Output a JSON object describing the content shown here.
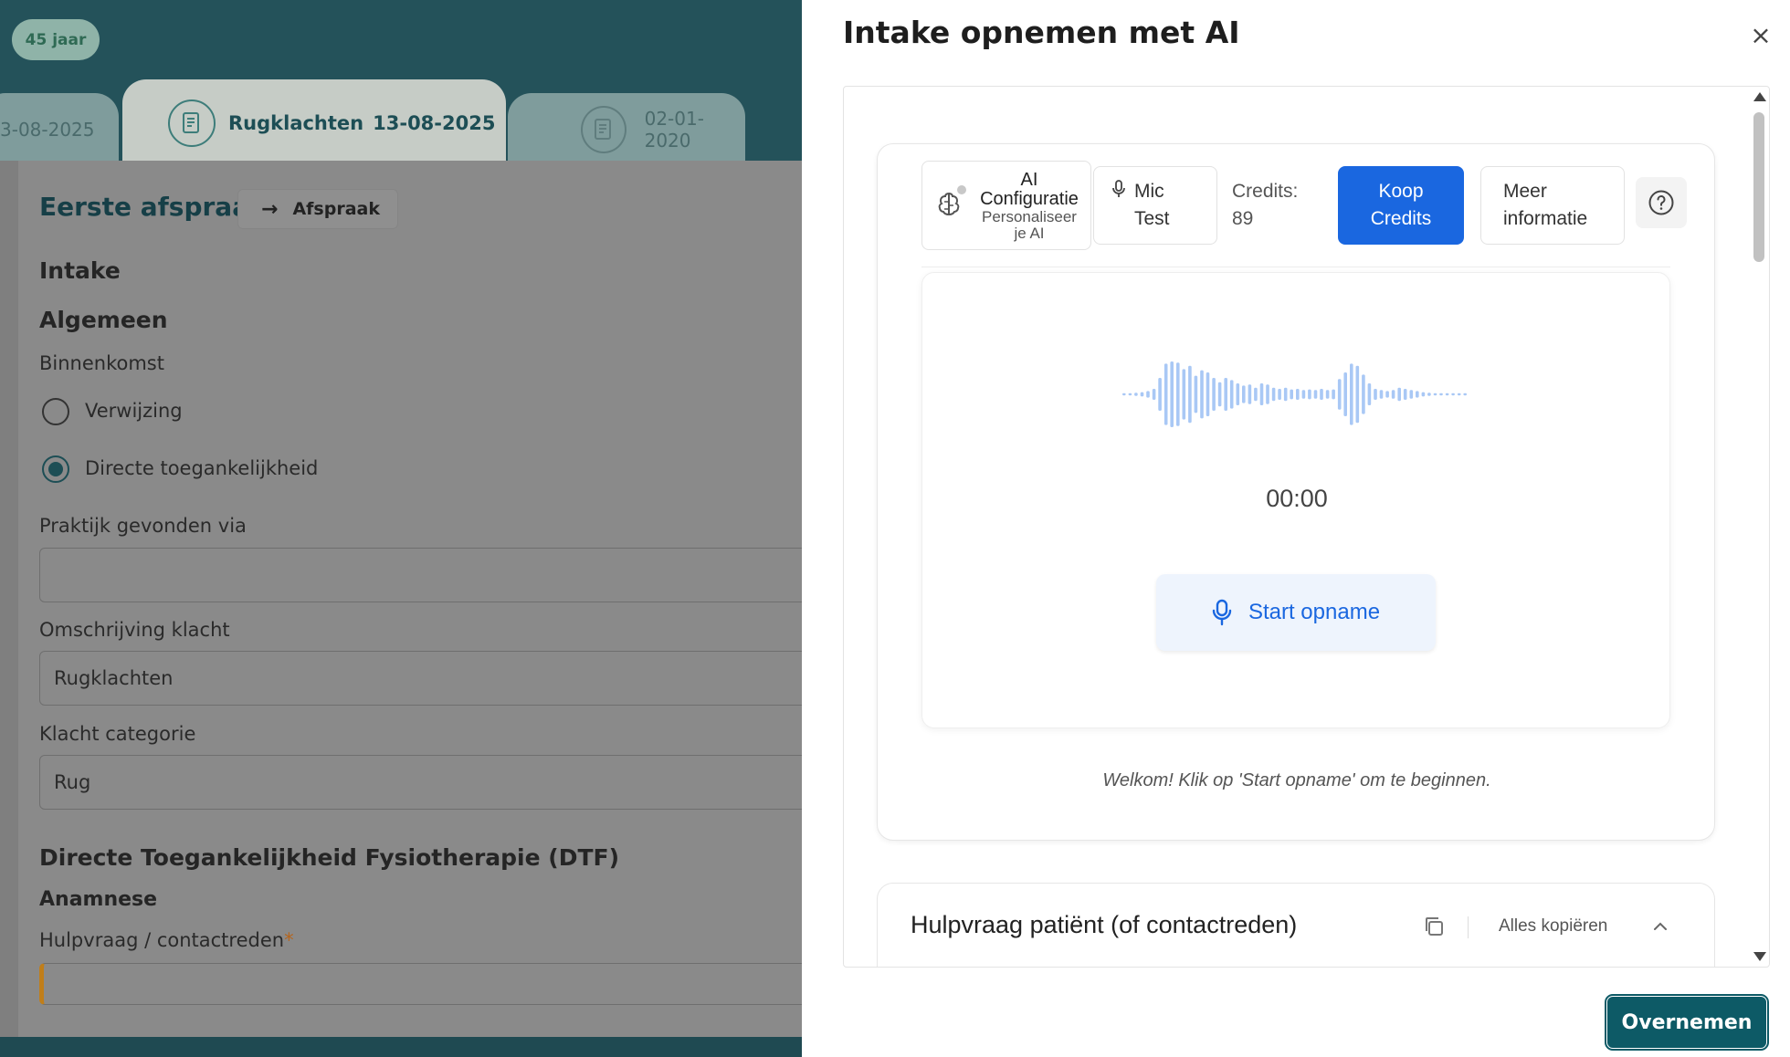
{
  "left": {
    "age_badge": "45 jaar",
    "tabs": [
      {
        "date": "3-08-2025"
      },
      {
        "title": "Rugklachten",
        "date": "13-08-2025"
      },
      {
        "date": "02-01-2020"
      }
    ],
    "section_heading": "Eerste afspraak",
    "afspraak_button": "Afspraak",
    "intake_heading": "Intake",
    "algemeen_heading": "Algemeen",
    "binnenkomst_label": "Binnenkomst",
    "radio_options": [
      {
        "label": "Verwijzing",
        "checked": false
      },
      {
        "label": "Directe toegankelijkheid",
        "checked": true
      }
    ],
    "praktijk_label": "Praktijk gevonden via",
    "praktijk_value": "",
    "omschrijving_label": "Omschrijving klacht",
    "omschrijving_value": "Rugklachten",
    "categorie_label": "Klacht categorie",
    "categorie_value": "Rug",
    "dtf_heading": "Directe Toegankelijkheid Fysiotherapie (DTF)",
    "anamnese_heading": "Anamnese",
    "hulpvraag_label": "Hulpvraag / contactreden",
    "required_marker": "*"
  },
  "drawer": {
    "title": "Intake opnemen met AI",
    "close_glyph": "×",
    "toolbar": {
      "ai_config_line1": "AI",
      "ai_config_line2": "Configuratie",
      "ai_config_sub1": "Personaliseer",
      "ai_config_sub2": "je AI",
      "mic_line1": "Mic",
      "mic_line2": "Test",
      "credits_label": "Credits:",
      "credits_value": "89",
      "koop_line1": "Koop",
      "koop_line2": "Credits",
      "meer_line1": "Meer",
      "meer_line2": "informatie"
    },
    "timer": "00:00",
    "start_button": "Start opname",
    "welcome_message": "Welkom! Klik op 'Start opname' om te beginnen.",
    "section": {
      "title": "Hulpvraag patiënt (of contactreden)",
      "copy_all": "Alles kopiëren"
    },
    "confirm_button": "Overnemen"
  },
  "colors": {
    "teal_dark": "#1f4a52",
    "accent_blue": "#1a67e0",
    "confirm_teal": "#0d5a66",
    "required_orange": "#c07e1a"
  }
}
